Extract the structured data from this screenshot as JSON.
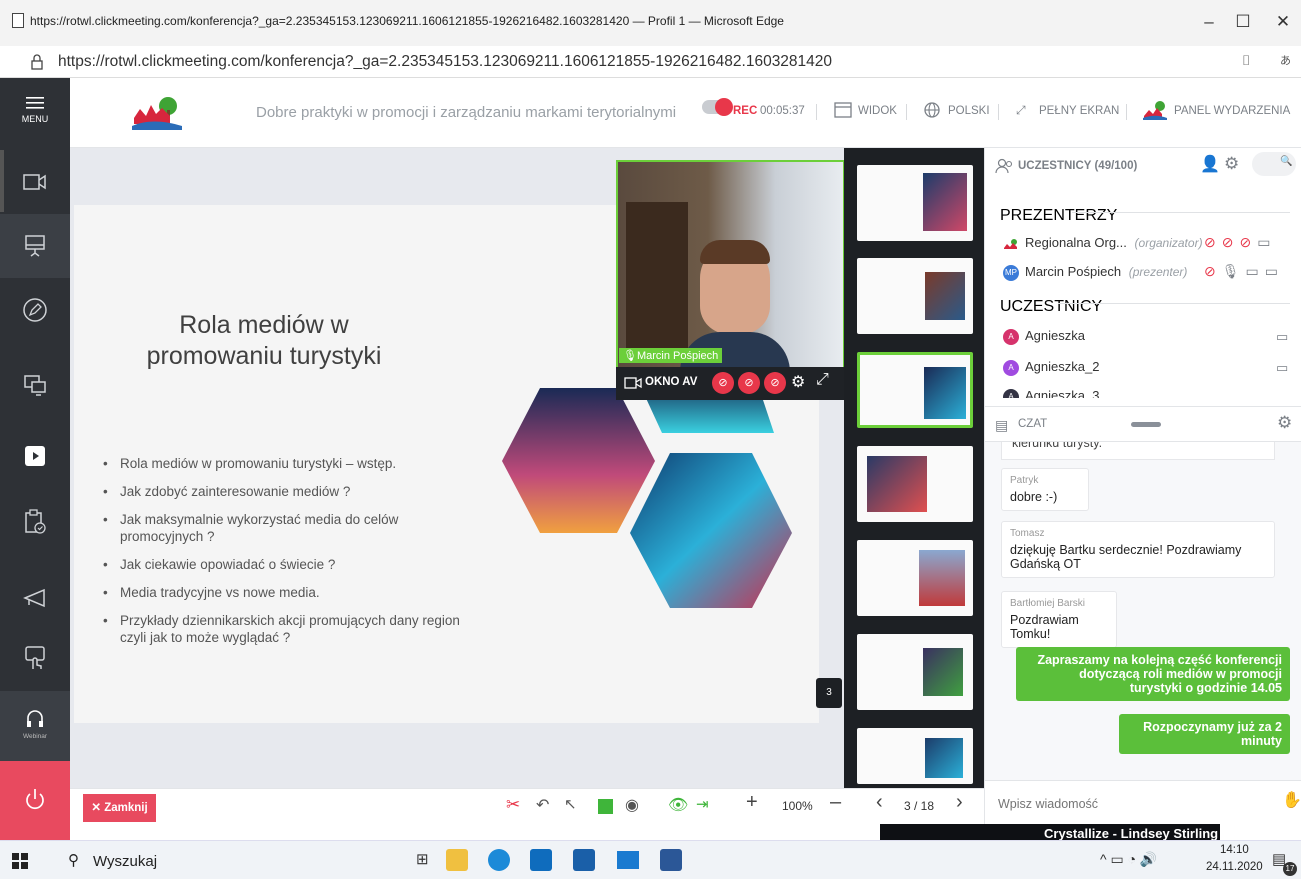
{
  "window": {
    "title": "https://rotwl.clickmeeting.com/konferencja?_ga=2.235345153.123069211.1606121855-1926216482.1603281420 — Profil 1 — Microsoft Edge",
    "url": "https://rotwl.clickmeeting.com/konferencja?_ga=2.235345153.123069211.1606121855-1926216482.1603281420"
  },
  "rail": {
    "menu_label": "MENU",
    "webinar_label": "Webinar"
  },
  "header": {
    "title": "Dobre praktyki w promocji i zarządzaniu markami terytorialnymi",
    "rec": "REC",
    "timer": "00:05:37",
    "view": "WIDOK",
    "language": "POLSKI",
    "fullscreen": "PEŁNY EKRAN",
    "event_panel": "PANEL WYDARZENIA"
  },
  "slide": {
    "title": "Rola mediów w promowaniu turystyki",
    "bullets": [
      "Rola mediów w promowaniu turystyki – wstęp.",
      "Jak zdobyć zainteresowanie mediów ?",
      "Jak maksymalnie wykorzystać media do celów promocyjnych ?",
      "Jak ciekawie opowiadać o świecie ?",
      "Media tradycyjne vs nowe media.",
      "Przykłady dziennikarskich akcji promujących dany region czyli jak to może wyglądać ?"
    ]
  },
  "video": {
    "speaker": "Marcin Pośpiech",
    "window_label": "OKNO AV"
  },
  "thumbs": {
    "page_badge": "3"
  },
  "participants": {
    "title": "UCZESTNICY (49/100)",
    "presenters_label": "PREZENTERZY",
    "attendees_label": "UCZESTNICY",
    "presenters": [
      {
        "name": "Regionalna Org...",
        "role": "(organizator)"
      },
      {
        "name": "Marcin Pośpiech",
        "role": "(prezenter)",
        "initials": "MP"
      }
    ],
    "attendees": [
      {
        "name": "Agnieszka",
        "initial": "A"
      },
      {
        "name": "Agnieszka_2",
        "initial": "A"
      },
      {
        "name": "Agnieszka_3",
        "initial": "A"
      }
    ]
  },
  "chat": {
    "title": "CZAT",
    "clipped_text": "kierunku turysty.",
    "messages": [
      {
        "author": "Patryk",
        "text": "dobre :-)"
      },
      {
        "author": "Tomasz",
        "text": "dziękuję Bartku serdecznie! Pozdrawiamy Gdańską OT"
      },
      {
        "author": "Bartłomiej Barski",
        "text": "Pozdrawiam Tomku!"
      }
    ],
    "own_messages": [
      "Zapraszamy na kolejną część konferencji dotyczącą roli mediów w promocji turystyki o godzinie 14.05",
      "Rozpoczynamy już za 2 minuty"
    ],
    "input_placeholder": "Wpisz wiadomość"
  },
  "bottom": {
    "close_label": "Zamknij",
    "zoom": "100%",
    "page": "3 / 18"
  },
  "taskbar": {
    "search": "Wyszukaj",
    "now_playing": "Crystallize - Lindsey Stirling",
    "time": "14:10",
    "date": "24.11.2020",
    "notif_count": "17"
  },
  "colors": {
    "accent_green": "#5bbf3a",
    "rec_red": "#e8374a",
    "close_red": "#e84a5f",
    "rail_dark": "#2e3136"
  }
}
